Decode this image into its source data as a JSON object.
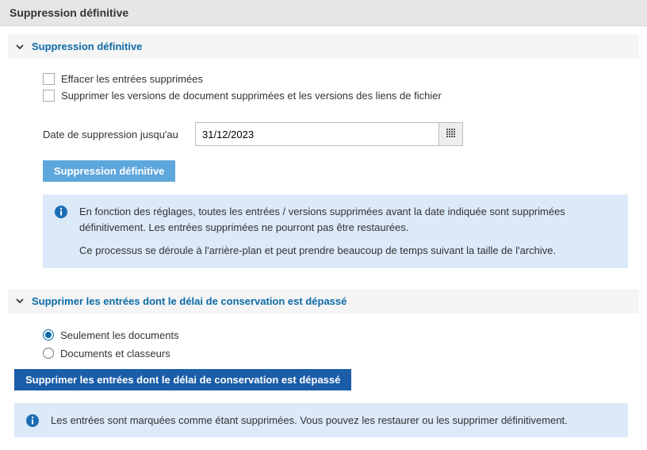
{
  "header": {
    "title": "Suppression définitive"
  },
  "section1": {
    "title": "Suppression définitive",
    "checkbox1_label": "Effacer les entrées supprimées",
    "checkbox2_label": "Supprimer les versions de document supprimées et les versions des liens de fichier",
    "date_label": "Date de suppression jusqu'au",
    "date_value": "31/12/2023",
    "button_label": "Suppression définitive",
    "info_p1": "En fonction des réglages, toutes les entrées / versions supprimées avant la date indiquée sont supprimées définitivement. Les entrées supprimées ne pourront pas être restaurées.",
    "info_p2": "Ce processus se déroule à l'arrière-plan et peut prendre beaucoup de temps suivant la taille de l'archive."
  },
  "section2": {
    "title": "Supprimer les entrées dont le délai de conservation est dépassé",
    "radio1_label": "Seulement les documents",
    "radio2_label": "Documents et classeurs",
    "button_label": "Supprimer les entrées dont le délai de conservation est dépassé",
    "info_p1": "Les entrées sont marquées comme étant supprimées. Vous pouvez les restaurer ou les supprimer définitivement."
  }
}
